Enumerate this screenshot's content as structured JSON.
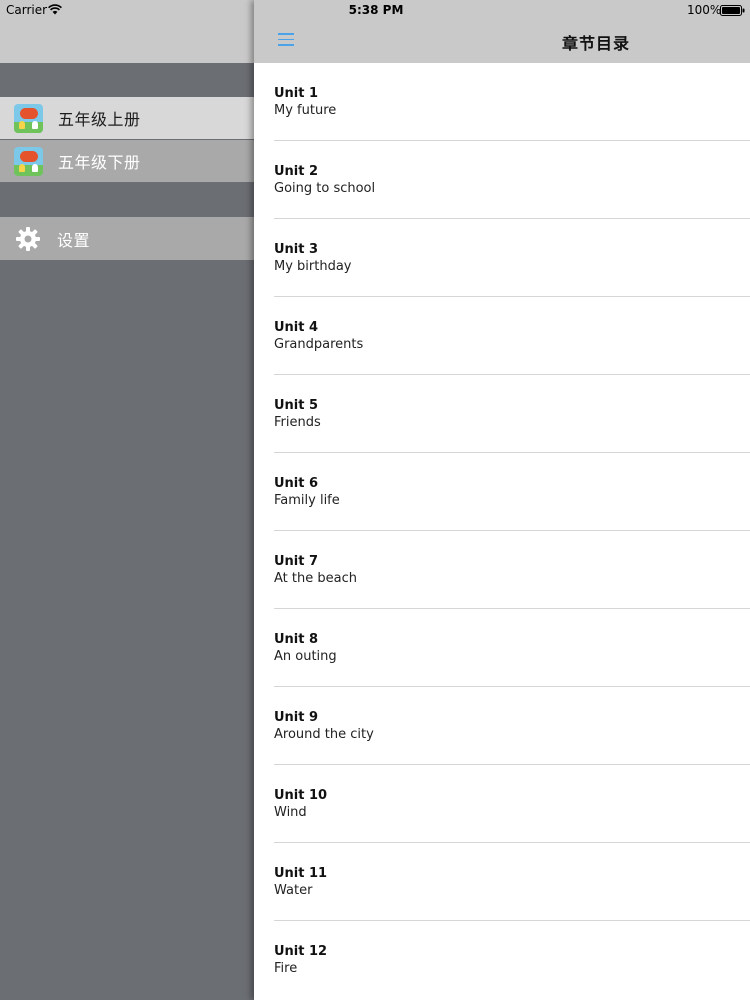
{
  "status_bar": {
    "carrier": "Carrier",
    "time": "5:38 PM",
    "battery": "100%"
  },
  "sidebar": {
    "books": [
      {
        "label": "五年级上册",
        "icon": "book-cover-icon",
        "selected": true
      },
      {
        "label": "五年级下册",
        "icon": "book-cover-icon",
        "selected": false
      }
    ],
    "settings": {
      "label": "设置",
      "icon": "gear-icon"
    }
  },
  "navbar": {
    "title": "章节目录",
    "menu_icon": "hamburger-icon",
    "accent": "#4aa3e8"
  },
  "units": [
    {
      "number": "Unit 1",
      "name": "My future"
    },
    {
      "number": "Unit 2",
      "name": "Going to school"
    },
    {
      "number": "Unit 3",
      "name": "My birthday"
    },
    {
      "number": "Unit 4",
      "name": "Grandparents"
    },
    {
      "number": "Unit 5",
      "name": "Friends"
    },
    {
      "number": "Unit 6",
      "name": "Family life"
    },
    {
      "number": "Unit 7",
      "name": "At the beach"
    },
    {
      "number": "Unit 8",
      "name": "An outing"
    },
    {
      "number": "Unit 9",
      "name": "Around the city"
    },
    {
      "number": "Unit 10",
      "name": "Wind"
    },
    {
      "number": "Unit 11",
      "name": "Water"
    },
    {
      "number": "Unit 12",
      "name": "Fire"
    }
  ]
}
